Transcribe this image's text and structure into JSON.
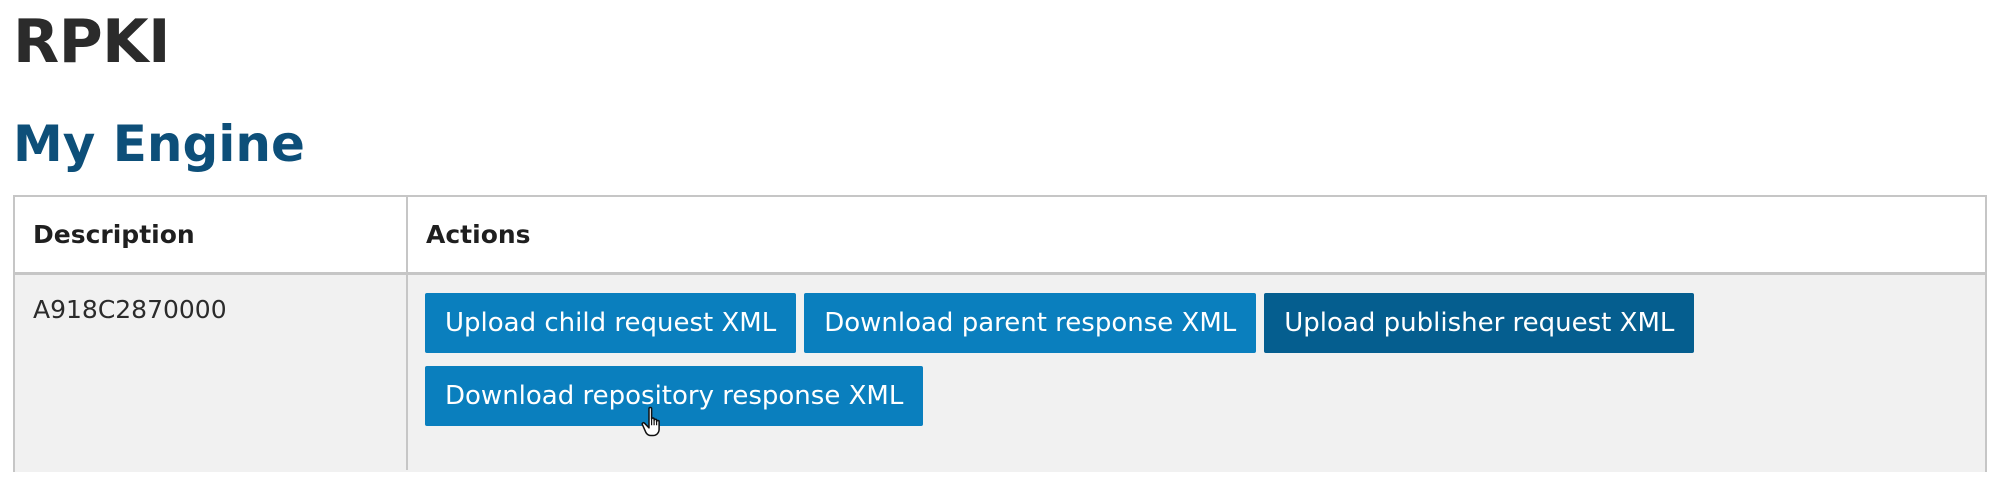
{
  "page": {
    "title": "RPKI",
    "section_title": "My Engine"
  },
  "table": {
    "headers": {
      "description": "Description",
      "actions": "Actions"
    },
    "rows": [
      {
        "description": "A918C2870000",
        "actions": [
          "Upload child request XML",
          "Download parent response XML",
          "Upload publisher request XML",
          "Download repository response XML"
        ],
        "hovered_action_index": 2
      }
    ]
  },
  "colors": {
    "button": "#0a7fbe",
    "button_hover": "#055e8f",
    "section_title": "#0d4f79"
  },
  "icons": [
    "hand-pointer-cursor-icon"
  ]
}
